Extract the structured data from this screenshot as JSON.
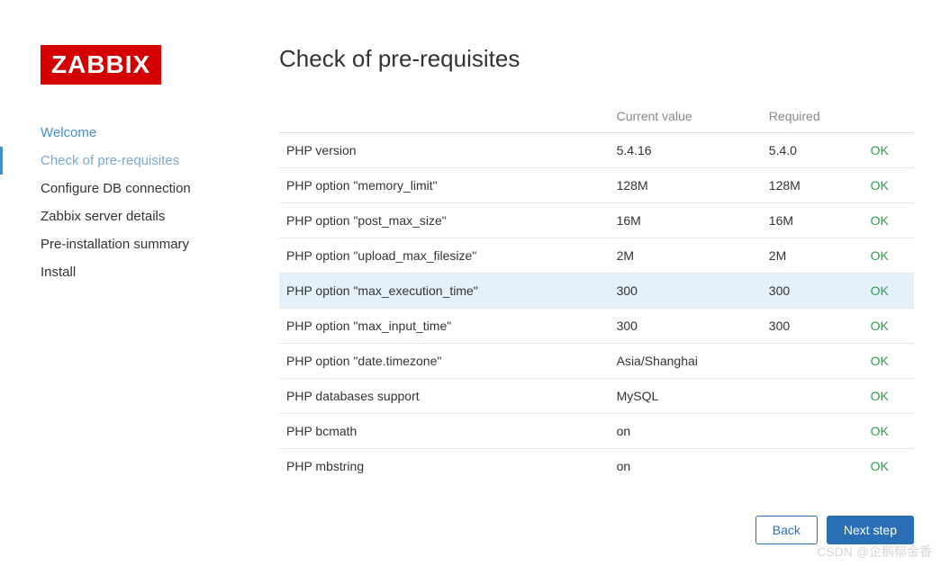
{
  "logo": "ZABBIX",
  "sidebar": {
    "items": [
      {
        "label": "Welcome",
        "state": "done"
      },
      {
        "label": "Check of pre-requisites",
        "state": "active"
      },
      {
        "label": "Configure DB connection",
        "state": "pending"
      },
      {
        "label": "Zabbix server details",
        "state": "pending"
      },
      {
        "label": "Pre-installation summary",
        "state": "pending"
      },
      {
        "label": "Install",
        "state": "pending"
      }
    ]
  },
  "main": {
    "title": "Check of pre-requisites",
    "headers": {
      "current": "Current value",
      "required": "Required"
    },
    "rows": [
      {
        "name": "PHP version",
        "current": "5.4.16",
        "required": "5.4.0",
        "status": "OK",
        "highlight": false
      },
      {
        "name": "PHP option \"memory_limit\"",
        "current": "128M",
        "required": "128M",
        "status": "OK",
        "highlight": false
      },
      {
        "name": "PHP option \"post_max_size\"",
        "current": "16M",
        "required": "16M",
        "status": "OK",
        "highlight": false
      },
      {
        "name": "PHP option \"upload_max_filesize\"",
        "current": "2M",
        "required": "2M",
        "status": "OK",
        "highlight": false
      },
      {
        "name": "PHP option \"max_execution_time\"",
        "current": "300",
        "required": "300",
        "status": "OK",
        "highlight": true
      },
      {
        "name": "PHP option \"max_input_time\"",
        "current": "300",
        "required": "300",
        "status": "OK",
        "highlight": false
      },
      {
        "name": "PHP option \"date.timezone\"",
        "current": "Asia/Shanghai",
        "required": "",
        "status": "OK",
        "highlight": false
      },
      {
        "name": "PHP databases support",
        "current": "MySQL",
        "required": "",
        "status": "OK",
        "highlight": false
      },
      {
        "name": "PHP bcmath",
        "current": "on",
        "required": "",
        "status": "OK",
        "highlight": false
      },
      {
        "name": "PHP mbstring",
        "current": "on",
        "required": "",
        "status": "OK",
        "highlight": false
      }
    ]
  },
  "footer": {
    "back": "Back",
    "next": "Next step"
  },
  "watermark": "CSDN @企鹅郁金香"
}
